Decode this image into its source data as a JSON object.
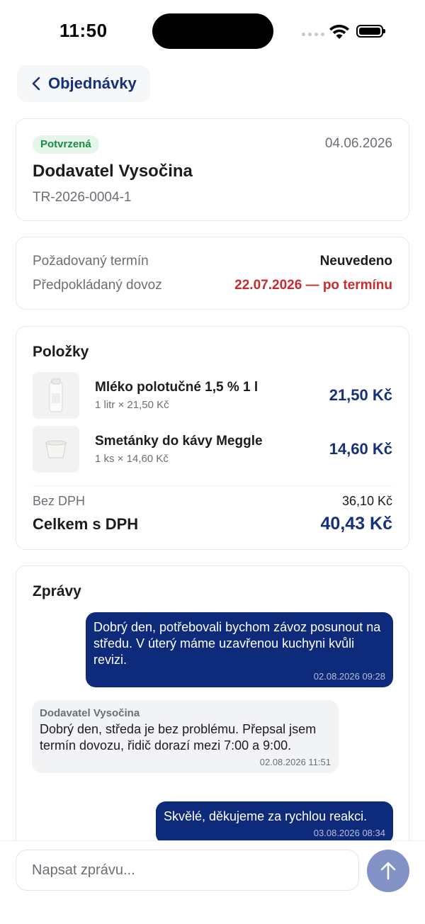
{
  "status_bar": {
    "time": "11:50"
  },
  "nav": {
    "back_label": "Objednávky"
  },
  "order": {
    "status": "Potvrzená",
    "date": "04.06.2026",
    "supplier": "Dodavatel Vysočina",
    "number": "TR-2026-0004-1",
    "status_color": "#1f8a44",
    "accent_color": "#16307a"
  },
  "dates": {
    "requested_label": "Požadovaný termín",
    "requested_value": "Neuvedeno",
    "expected_label": "Předpokládaný dovoz",
    "expected_value": "22.07.2026 — po termínu",
    "late_color": "#c62c2c"
  },
  "items": {
    "title": "Položky",
    "list": [
      {
        "name": "Mléko polotučné 1,5 % 1 l",
        "qty": "1 litr × 21,50 Kč",
        "price": "21,50 Kč",
        "image": "milk-bottle-icon"
      },
      {
        "name": "Smetánky do kávy Meggle",
        "qty": "1 ks × 14,60 Kč",
        "price": "14,60 Kč",
        "image": "creamer-cup-icon"
      }
    ],
    "net_label": "Bez DPH",
    "net_value": "36,10 Kč",
    "gross_label": "Celkem s DPH",
    "gross_value": "40,43 Kč"
  },
  "messages": {
    "title": "Zprávy",
    "list": [
      {
        "direction": "out",
        "text": "Dobrý den, potřebovali bychom závoz posunout na středu. V úterý máme uzavřenou kuchyni kvůli revizi.",
        "time": "02.08.2026 09:28"
      },
      {
        "direction": "in",
        "author": "Dodavatel Vysočina",
        "text": "Dobrý den, středa je bez problému. Přepsal jsem termín dovozu, řidič dorazí mezi 7:00 a 9:00.",
        "time": "02.08.2026 11:51"
      },
      {
        "direction": "out",
        "text": "Skvělé, děkujeme za rychlou reakci.",
        "time": "03.08.2026 08:34"
      }
    ]
  },
  "composer": {
    "placeholder": "Napsat zprávu..."
  }
}
